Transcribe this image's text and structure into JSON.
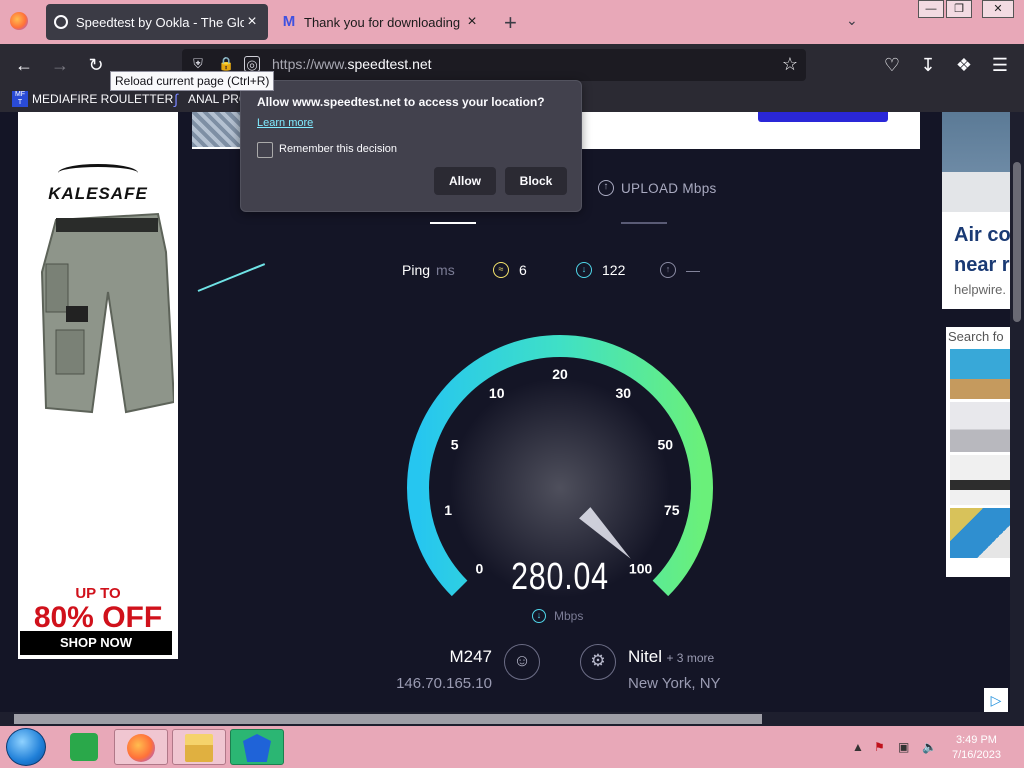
{
  "browser": {
    "tabs": [
      {
        "label": "Speedtest by Ookla - The Global Broadband Speed Test",
        "active": true
      },
      {
        "label": "Thank you for downloading Malwarebytes",
        "active": false
      }
    ],
    "url_protocol": "https://www.",
    "url_host": "speedtest.net",
    "tooltip": "Reload current page (Ctrl+R)",
    "bookmarks": [
      "MEDIAFIRE ROULETTER",
      "ANAL PRO"
    ],
    "bookmark_icon_text": "MF T"
  },
  "permission_popup": {
    "question": "Allow www.speedtest.net to access your location?",
    "learn_more": "Learn more",
    "remember": "Remember this decision",
    "allow": "Allow",
    "block": "Block"
  },
  "speedtest": {
    "upload_header": "UPLOAD Mbps",
    "ping_label": "Ping",
    "ping_unit": "ms",
    "ping_idle": "6",
    "ping_download": "122",
    "ping_upload": "—",
    "speed_value": "280.04",
    "speed_unit": "Mbps",
    "gauge_ticks": [
      "0",
      "1",
      "5",
      "10",
      "20",
      "30",
      "50",
      "75",
      "100"
    ],
    "needle_value": 100,
    "isp_name": "M247",
    "isp_ip": "146.70.165.10",
    "server_name": "Nitel",
    "server_more": "+ 3 more",
    "server_location": "New York, NY",
    "colors": {
      "gauge_start": "#26c6f0",
      "gauge_end": "#6af07a"
    }
  },
  "ads": {
    "left_brand": "KALESAFE",
    "left_upto": "UP TO",
    "left_off": "80% OFF",
    "left_shop": "SHOP NOW",
    "right_headline_1": "Air co",
    "right_headline_2": "near r",
    "right_domain": "helpwire.",
    "right_search": "Search fo"
  },
  "taskbar": {
    "time": "3:49 PM",
    "date": "7/16/2023"
  }
}
